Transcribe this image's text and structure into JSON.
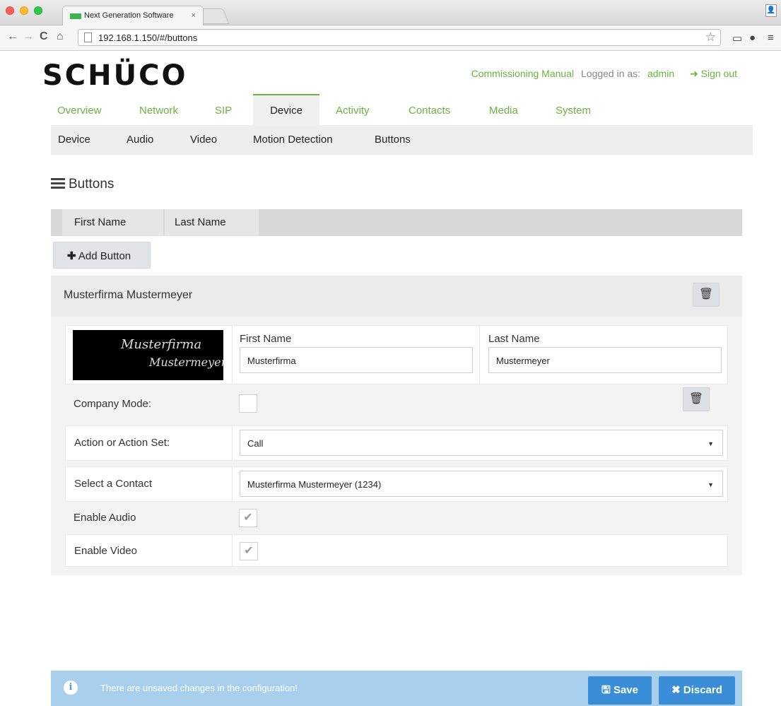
{
  "browser": {
    "tab_title": "Next Generation Software",
    "tab_close": "×",
    "url": "192.168.1.150/#/buttons"
  },
  "header": {
    "logo": "SCHÜCO",
    "manual_link": "Commissioning Manual",
    "logged_in_label": "Logged in as:",
    "user": "admin",
    "sign_out": "Sign out"
  },
  "main_nav": [
    "Overview",
    "Network",
    "SIP",
    "Device",
    "Activity",
    "Contacts",
    "Media",
    "System"
  ],
  "sub_nav": [
    "Device",
    "Audio",
    "Video",
    "Motion Detection",
    "Buttons"
  ],
  "page_title": "Buttons",
  "table_header": {
    "first_name": "First Name",
    "last_name": "Last Name"
  },
  "add_button_label": "Add Button",
  "entry": {
    "title": "Musterfirma Mustermeyer",
    "image_text_1": "Musterfirma",
    "image_text_2": "Mustermeyer",
    "first_name_label": "First Name",
    "first_name_value": "Musterfirma",
    "last_name_label": "Last Name",
    "last_name_value": "Mustermeyer",
    "company_mode_label": "Company Mode:",
    "action_label": "Action or Action Set:",
    "action_value": "Call",
    "contact_label": "Select a Contact",
    "contact_value": "Musterfirma Mustermeyer (1234)",
    "enable_audio_label": "Enable Audio",
    "enable_video_label": "Enable Video",
    "company_mode_checked": false,
    "enable_audio_checked": true,
    "enable_video_checked": true
  },
  "footer": {
    "message": "There are unsaved changes in the configuration!",
    "save": "Save",
    "discard": "Discard"
  },
  "colors": {
    "accent_green": "#6cb33f",
    "footer_bg": "#a8cfeb",
    "button_blue": "#3a8ed8"
  }
}
